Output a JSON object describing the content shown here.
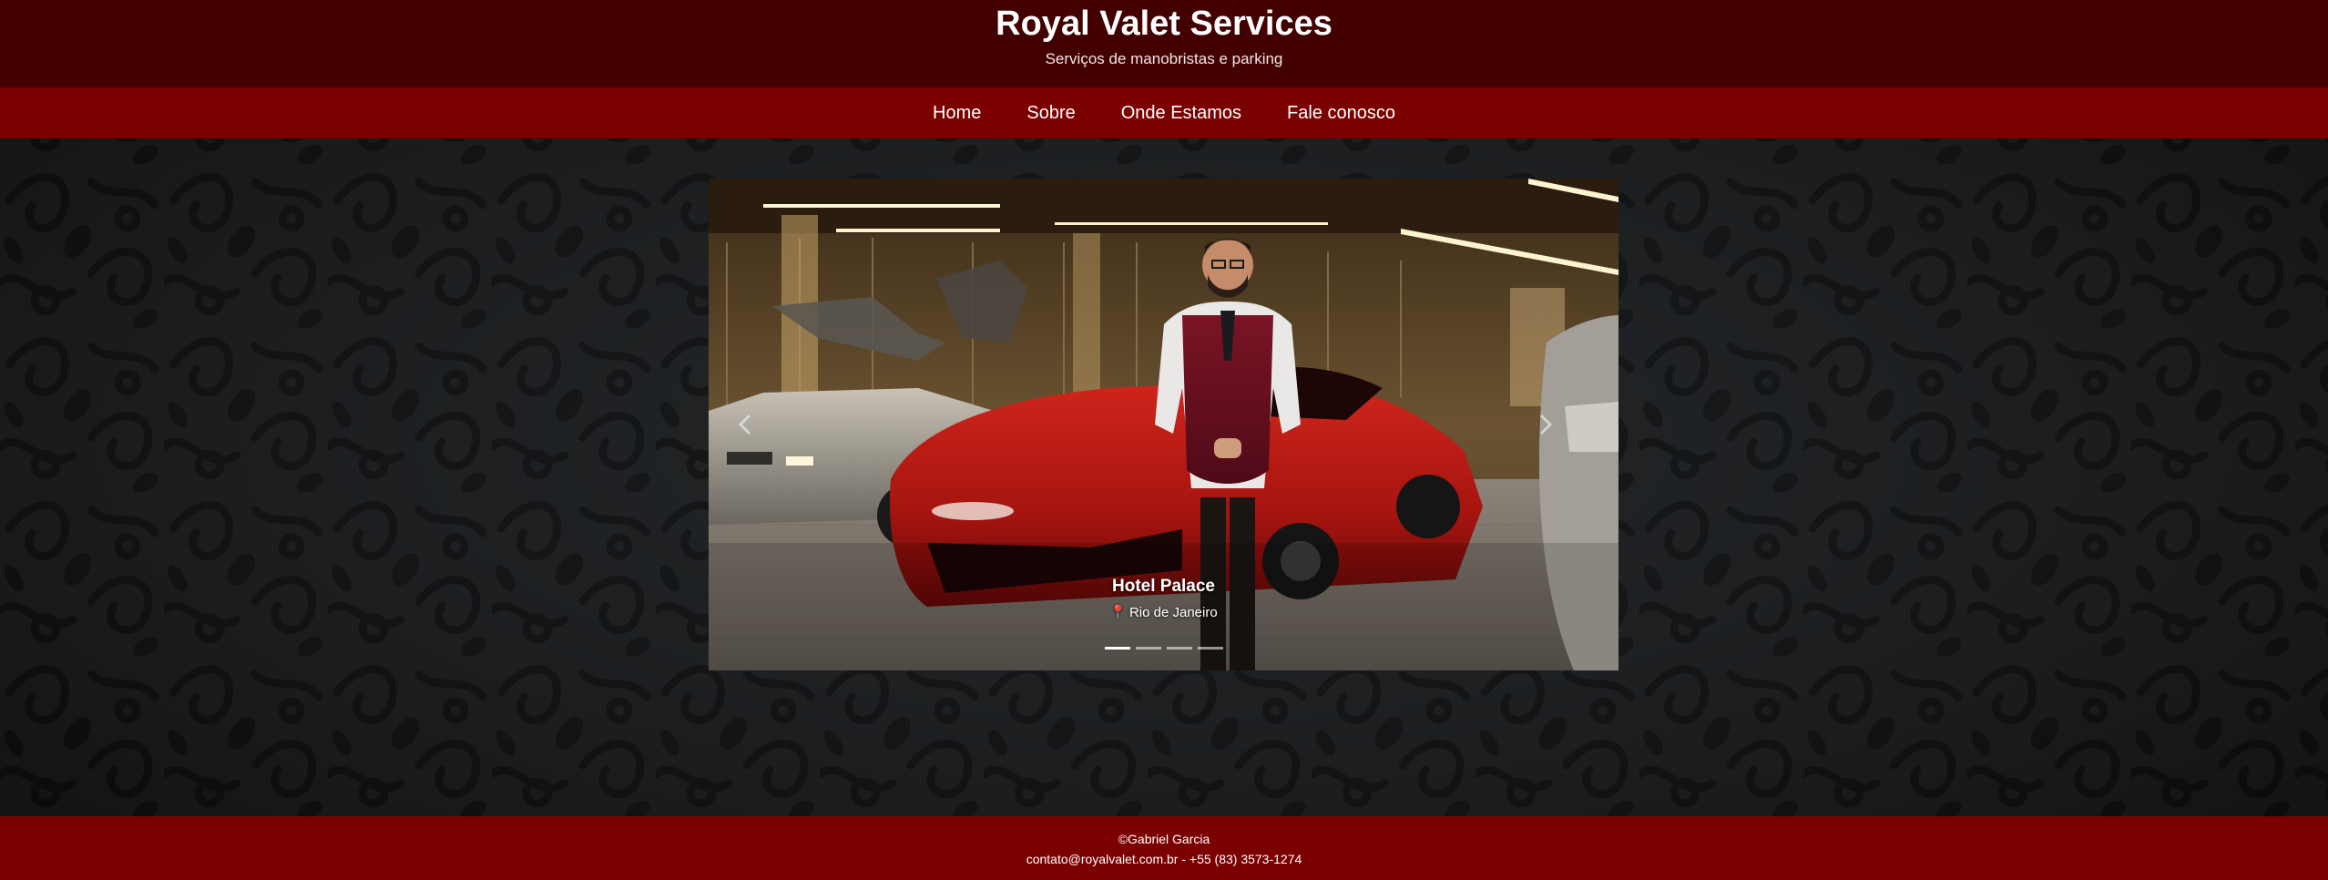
{
  "header": {
    "title": "Royal Valet Services",
    "subtitle": "Serviços de manobristas e parking"
  },
  "nav": {
    "items": [
      {
        "label": "Home"
      },
      {
        "label": "Sobre"
      },
      {
        "label": "Onde Estamos"
      },
      {
        "label": "Fale conosco"
      }
    ]
  },
  "carousel": {
    "slide": {
      "title": "Hotel Palace",
      "location": "Rio de Janeiro",
      "location_icon": "map-pin-icon"
    },
    "indicator_count": 4,
    "active_indicator": 1,
    "prev_icon": "chevron-left-icon",
    "next_icon": "chevron-right-icon"
  },
  "footer": {
    "copyright": "©Gabriel Garcia",
    "contact": "contato@royalvalet.com.br - +55 (83) 3573-1274"
  },
  "colors": {
    "header_bg": "#430000",
    "nav_bg": "#7b0000",
    "footer_bg": "#7b0000",
    "page_bg": "#1b1d1f"
  }
}
